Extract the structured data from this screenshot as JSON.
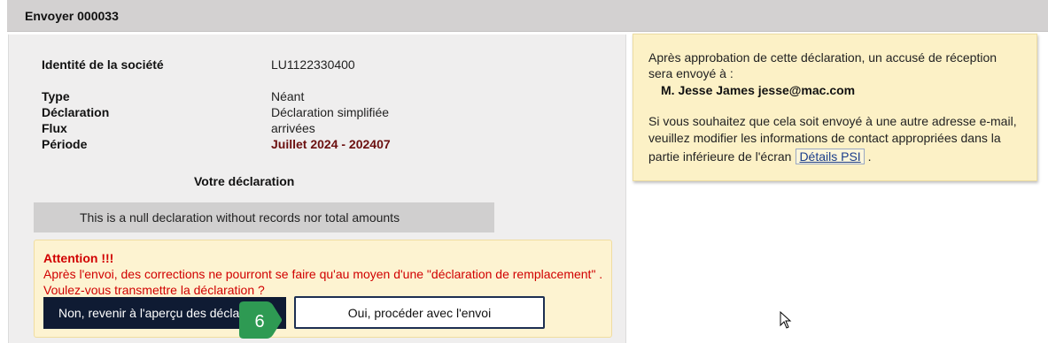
{
  "header": {
    "title": "Envoyer 000033"
  },
  "company": {
    "identity_label": "Identité de la société",
    "identity_value": "LU1122330400",
    "type_label": "Type",
    "type_value": "Néant",
    "declaration_label": "Déclaration",
    "declaration_value": "Déclaration simplifiée",
    "flux_label": "Flux",
    "flux_value": "arrivées",
    "period_label": "Période",
    "period_value": "Juillet 2024 - 202407"
  },
  "declaration_section": {
    "title": "Votre déclaration",
    "null_message": "This is a null declaration without records nor total amounts"
  },
  "warning": {
    "title": "Attention !!!",
    "line1": "Après l'envoi, des corrections ne pourront se faire qu'au moyen d'une \"déclaration de remplacement\" .",
    "line2": "Voulez-vous transmettre la déclaration ?",
    "no_button": "Non, revenir à l'aperçu des déclarations",
    "yes_button": "Oui, procéder avec l'envoi"
  },
  "step_badge": {
    "number": "6",
    "color": "#2e9a53"
  },
  "info": {
    "line1": "Après approbation de cette déclaration, un accusé de réception",
    "line2": "sera envoyé à :",
    "recipient": "M. Jesse James jesse@mac.com",
    "line3": "Si vous souhaitez que cela soit envoyé à une autre adresse e-mail,",
    "line4": "veuillez modifier les informations de contact appropriées dans la",
    "line5": "partie inférieure de l'écran",
    "link": "Détails PSI",
    "line5_end": "."
  },
  "colors": {
    "dark_button": "#0f1b33",
    "warning_text": "#d10000",
    "period_text": "#6b1010",
    "info_bg": "#fcf1c6"
  }
}
